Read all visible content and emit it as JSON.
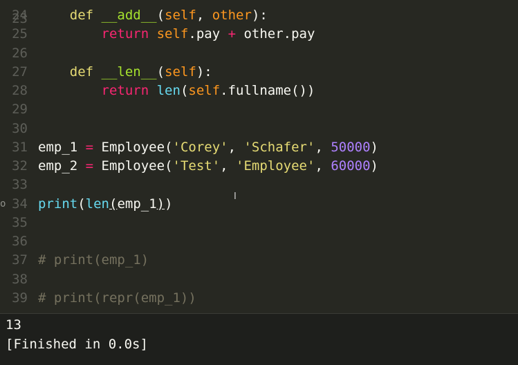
{
  "editor": {
    "lines": [
      {
        "n": "24",
        "tokens": [
          [
            "    ",
            "plain"
          ],
          [
            "def",
            "defkw"
          ],
          [
            " ",
            "plain"
          ],
          [
            "__add__",
            "fn"
          ],
          [
            "(",
            "plain"
          ],
          [
            "self",
            "param"
          ],
          [
            ", ",
            "plain"
          ],
          [
            "other",
            "param"
          ],
          [
            "):",
            "plain"
          ]
        ]
      },
      {
        "n": "25",
        "tokens": [
          [
            "        ",
            "plain"
          ],
          [
            "return",
            "retkw"
          ],
          [
            " ",
            "plain"
          ],
          [
            "self",
            "self"
          ],
          [
            ".pay ",
            "plain"
          ],
          [
            "+",
            "op"
          ],
          [
            " other.pay",
            "plain"
          ]
        ]
      },
      {
        "n": "26",
        "tokens": []
      },
      {
        "n": "27",
        "tokens": [
          [
            "    ",
            "plain"
          ],
          [
            "def",
            "defkw"
          ],
          [
            " ",
            "plain"
          ],
          [
            "__len__",
            "fn"
          ],
          [
            "(",
            "plain"
          ],
          [
            "self",
            "param"
          ],
          [
            "):",
            "plain"
          ]
        ]
      },
      {
        "n": "28",
        "tokens": [
          [
            "        ",
            "plain"
          ],
          [
            "return",
            "retkw"
          ],
          [
            " ",
            "plain"
          ],
          [
            "len",
            "builtin"
          ],
          [
            "(",
            "plain"
          ],
          [
            "self",
            "self"
          ],
          [
            ".fullname())",
            "plain"
          ]
        ]
      },
      {
        "n": "29",
        "tokens": []
      },
      {
        "n": "30",
        "tokens": []
      },
      {
        "n": "31",
        "tokens": [
          [
            "emp_1 ",
            "plain"
          ],
          [
            "=",
            "op"
          ],
          [
            " ",
            "plain"
          ],
          [
            "Employee",
            "plain"
          ],
          [
            "(",
            "plain"
          ],
          [
            "'Corey'",
            "str"
          ],
          [
            ", ",
            "plain"
          ],
          [
            "'Schafer'",
            "str"
          ],
          [
            ", ",
            "plain"
          ],
          [
            "50000",
            "num"
          ],
          [
            ")",
            "plain"
          ]
        ]
      },
      {
        "n": "32",
        "tokens": [
          [
            "emp_2 ",
            "plain"
          ],
          [
            "=",
            "op"
          ],
          [
            " ",
            "plain"
          ],
          [
            "Employee",
            "plain"
          ],
          [
            "(",
            "plain"
          ],
          [
            "'Test'",
            "str"
          ],
          [
            ", ",
            "plain"
          ],
          [
            "'Employee'",
            "str"
          ],
          [
            ", ",
            "plain"
          ],
          [
            "60000",
            "num"
          ],
          [
            ")",
            "plain"
          ]
        ]
      },
      {
        "n": "33",
        "tokens": []
      },
      {
        "n": "34",
        "tokens": [
          [
            "print",
            "builtin"
          ],
          [
            "(",
            "plain"
          ],
          [
            "len",
            "builtin"
          ],
          [
            "(",
            "ul"
          ],
          [
            "emp_1",
            "plain"
          ],
          [
            ")",
            "ul"
          ],
          [
            ")",
            "plain"
          ]
        ]
      },
      {
        "n": "35",
        "tokens": []
      },
      {
        "n": "36",
        "tokens": []
      },
      {
        "n": "37",
        "tokens": [
          [
            "# print(emp_1)",
            "cm"
          ]
        ]
      },
      {
        "n": "38",
        "tokens": []
      },
      {
        "n": "39",
        "tokens": [
          [
            "# print(repr(emp_1))",
            "cm"
          ]
        ]
      }
    ],
    "partial_top_line": "23",
    "cursor_glyph": "I",
    "fold_marker_line": "34",
    "fold_marker_glyph": "o"
  },
  "output": {
    "lines": [
      "13",
      "[Finished in 0.0s]"
    ]
  },
  "colors": {
    "editor_bg": "#272822",
    "output_bg": "#1e1f1c",
    "keyword": "#e6db74",
    "function": "#a6e22e",
    "string": "#e6db74",
    "number": "#ae81ff",
    "builtin": "#66d9ef",
    "comment": "#75715e",
    "parameter": "#fd971f",
    "operator": "#f92672"
  }
}
